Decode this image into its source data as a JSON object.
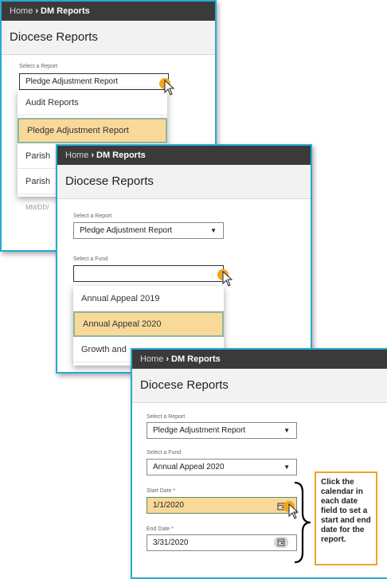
{
  "breadcrumb": {
    "home": "Home",
    "current": "DM Reports"
  },
  "page_title": "Diocese Reports",
  "report_select": {
    "label": "Select a Report",
    "value": "Pledge Adjustment Report",
    "options": [
      "Audit Reports",
      "Pledge Adjustment Report",
      "Parish",
      "Parish"
    ]
  },
  "fund_select": {
    "label": "Select a Fund",
    "value": "Annual Appeal 2020",
    "options": [
      "Annual Appeal 2019",
      "Annual Appeal 2020",
      "Growth and"
    ]
  },
  "date_placeholder": "MM/DD/",
  "start_date": {
    "label": "Start Date *",
    "value": "1/1/2020"
  },
  "end_date": {
    "label": "End Date *",
    "value": "3/31/2020"
  },
  "callout": "Click the calendar in each date field to set a start and end date for the report.",
  "colors": {
    "accent_border": "#29a9d2",
    "highlight": "#f8d99a",
    "cursor": "#f2a51f"
  }
}
